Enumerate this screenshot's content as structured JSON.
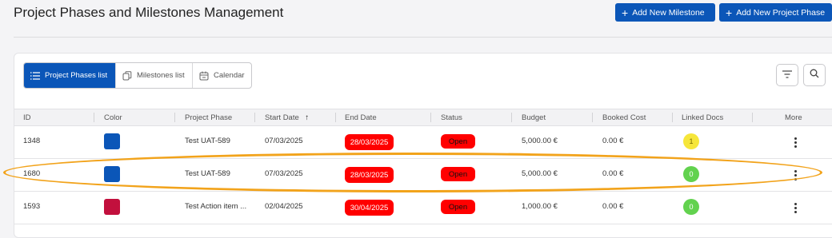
{
  "page": {
    "title": "Project Phases and Milestones Management"
  },
  "header_buttons": {
    "add_milestone": "Add New Milestone",
    "add_phase": "Add New Project Phase"
  },
  "view_switch": {
    "phases": "Project Phases list",
    "milestones": "Milestones list",
    "calendar": "Calendar"
  },
  "table": {
    "columns": [
      "ID",
      "Color",
      "Project Phase",
      "Start Date",
      "End Date",
      "Status",
      "Budget",
      "Booked Cost",
      "Linked Docs",
      "More"
    ],
    "sort_indicator": "↑",
    "rows": [
      {
        "id": "1348",
        "color": "#0b56b8",
        "phase": "Test UAT-589",
        "start": "07/03/2025",
        "end": "28/03/2025",
        "status": "Open",
        "budget": "5,000.00 €",
        "booked": "0.00 €",
        "docs": "1",
        "docs_color": "#f6e63a"
      },
      {
        "id": "1680",
        "color": "#0b56b8",
        "phase": "Test UAT-589",
        "start": "07/03/2025",
        "end": "28/03/2025",
        "status": "Open",
        "budget": "5,000.00 €",
        "booked": "0.00 €",
        "docs": "0",
        "docs_color": "#62d24e"
      },
      {
        "id": "1593",
        "color": "#c2103d",
        "phase": "Test Action item ...",
        "start": "02/04/2025",
        "end": "30/04/2025",
        "status": "Open",
        "budget": "1,000.00 €",
        "booked": "0.00 €",
        "docs": "0",
        "docs_color": "#62d24e"
      }
    ]
  },
  "icons": {
    "plus": "plus-icon",
    "list": "list-icon",
    "copy": "copy-icon",
    "calendar": "calendar-icon",
    "filter": "filter-icon",
    "search": "search-icon",
    "more": "more-vertical-icon"
  },
  "colors": {
    "primary": "#0b56b8",
    "danger": "#ff0000",
    "highlight": "#f2a31b"
  }
}
